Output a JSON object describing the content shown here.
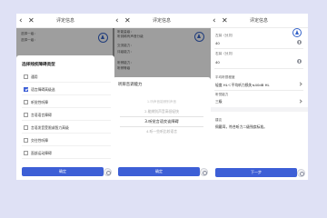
{
  "nav": {
    "back_icon": "‹",
    "close_icon": "✕",
    "title": "评定信息"
  },
  "screen1": {
    "bg_rows": [
      "选择一级：",
      "选择一级："
    ],
    "sheet_title": "选择残疾障碍类型",
    "options": [
      {
        "label": "通用",
        "checked": false
      },
      {
        "label": "语言障碍高级选",
        "checked": true
      },
      {
        "label": "听觉性听障",
        "checked": false
      },
      {
        "label": "言语语言障碍",
        "checked": false
      },
      {
        "label": "言语发音受限或智力高级",
        "checked": false
      },
      {
        "label": "交往性听障",
        "checked": false
      },
      {
        "label": "面部运动障碍",
        "checked": false
      }
    ],
    "confirm_label": "确定"
  },
  "screen2": {
    "bg_rows": [
      "听能量级：",
      "听到稀有声音分级",
      "交流能力：",
      "评级能力：",
      "",
      "听辨能力：",
      "听辨等级"
    ],
    "sheet_title": "听辨音调能力",
    "picker_items": [
      {
        "text": "1.听声音能辨别声音",
        "selected": false
      },
      {
        "text": "2.能辨别声音高低轻快",
        "selected": false
      },
      {
        "text": "3.听觉言语交谈障碍",
        "selected": true
      },
      {
        "text": "4.听一些听比较语言",
        "selected": false
      }
    ],
    "confirm_label": "确定"
  },
  "screen3": {
    "fields": [
      {
        "label": "左耳（分贝）",
        "value": "40"
      },
      {
        "label": "右耳（分贝）",
        "value": "40"
      },
      {
        "label": "平均听损程度",
        "value": "轻度 HL＜平均听力损失≤40dB HL"
      },
      {
        "label": "听觉能力",
        "value": "三级"
      }
    ],
    "remark_label": "建议",
    "remark_text": "佩戴耳，符合听力二级残疾标准。",
    "next_label": "下一步"
  },
  "colors": {
    "background": "#dfe1f5",
    "primary": "#3d5fd6",
    "logo": "#3563c9"
  }
}
